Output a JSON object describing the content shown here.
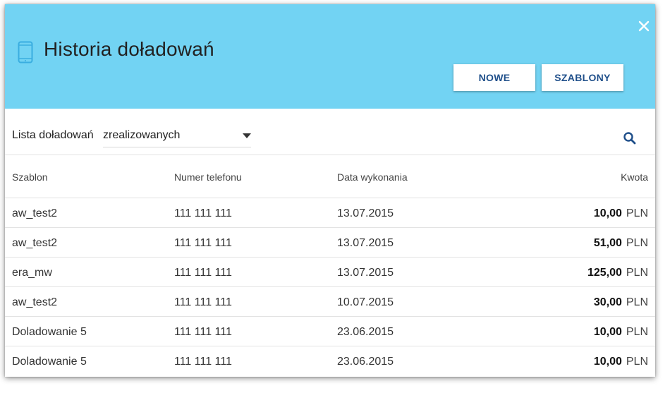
{
  "header": {
    "title": "Historia doładowań",
    "new_label": "NOWE",
    "templates_label": "SZABLONY"
  },
  "filter": {
    "label": "Lista doładowań",
    "selected": "zrealizowanych"
  },
  "table": {
    "columns": [
      "Szablon",
      "Numer telefonu",
      "Data wykonania",
      "Kwota"
    ],
    "rows": [
      {
        "template": "aw_test2",
        "phone": "111 111 111",
        "date": "13.07.2015",
        "amount": "10,00",
        "currency": "PLN"
      },
      {
        "template": "aw_test2",
        "phone": "111 111 111",
        "date": "13.07.2015",
        "amount": "51,00",
        "currency": "PLN"
      },
      {
        "template": "era_mw",
        "phone": "111 111 111",
        "date": "13.07.2015",
        "amount": "125,00",
        "currency": "PLN"
      },
      {
        "template": "aw_test2",
        "phone": "111 111 111",
        "date": "10.07.2015",
        "amount": "30,00",
        "currency": "PLN"
      },
      {
        "template": "Doladowanie 5",
        "phone": "111 111 111",
        "date": "23.06.2015",
        "amount": "10,00",
        "currency": "PLN"
      },
      {
        "template": "Doladowanie 5",
        "phone": "111 111 111",
        "date": "23.06.2015",
        "amount": "10,00",
        "currency": "PLN"
      }
    ]
  },
  "icons": {
    "header_icon": "phone-icon",
    "close": "close-icon",
    "dropdown": "caret-down-icon",
    "search": "search-icon"
  },
  "colors": {
    "header_bg": "#72d3f3",
    "button_text": "#1f4f8a",
    "icon_blue": "#1f4f8a",
    "phone_icon": "#3aaee0"
  }
}
